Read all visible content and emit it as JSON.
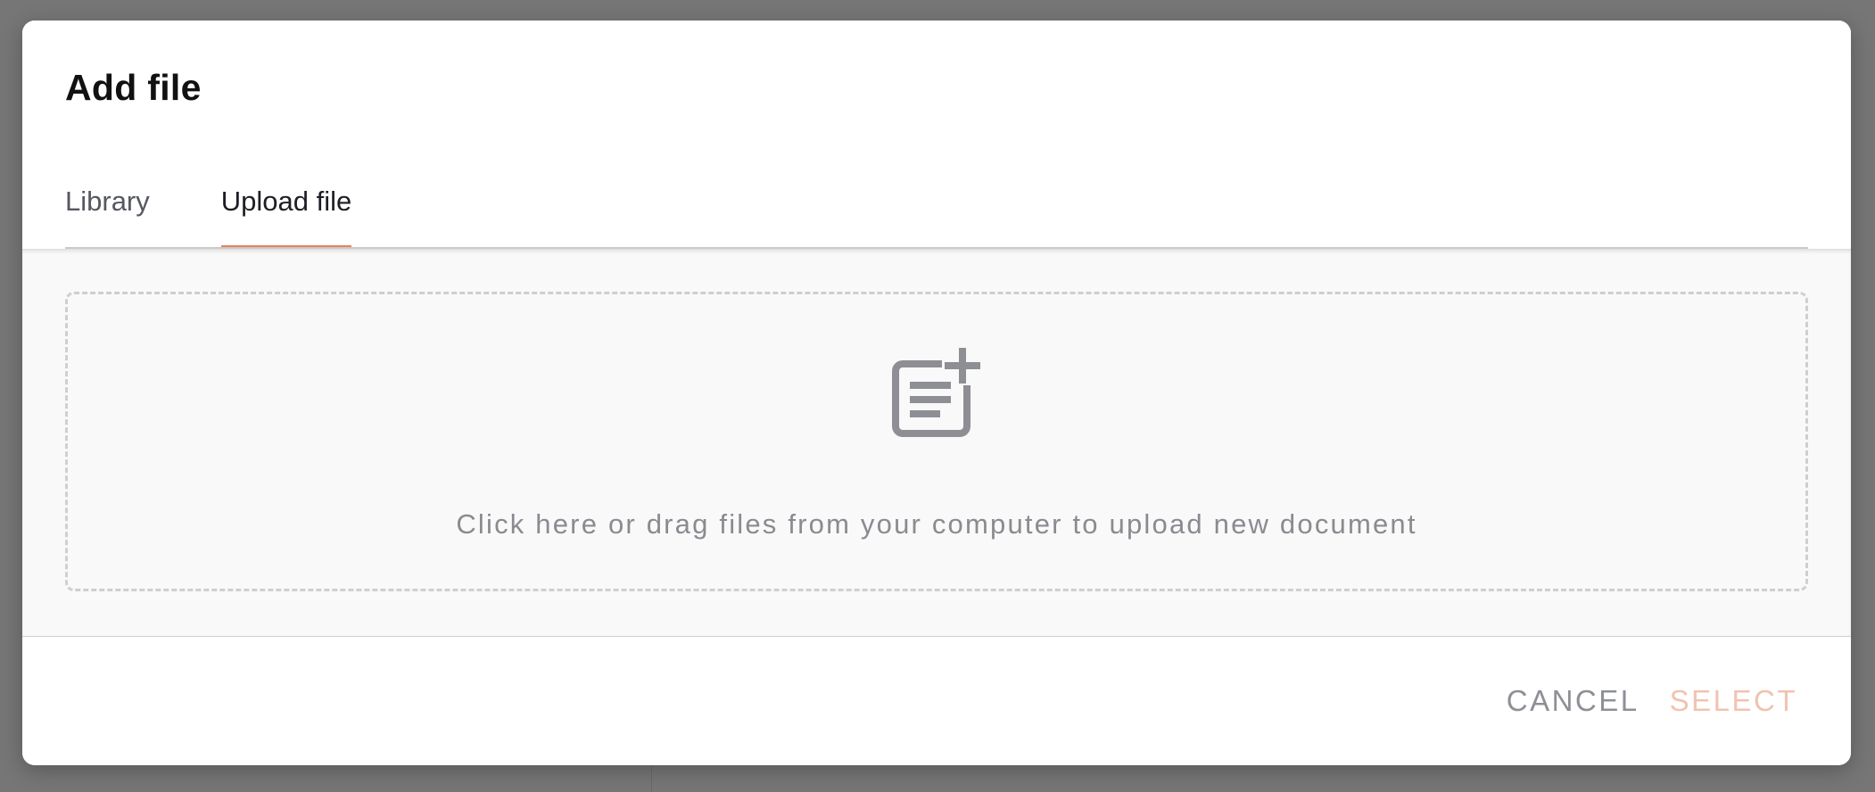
{
  "dialog": {
    "title": "Add file"
  },
  "tabs": [
    {
      "label": "Library",
      "active": false
    },
    {
      "label": "Upload file",
      "active": true
    }
  ],
  "dropzone": {
    "icon": "note-add-icon",
    "text": "Click here or drag files from your computer to upload new document"
  },
  "footer": {
    "cancel_label": "CANCEL",
    "select_label": "SELECT"
  },
  "colors": {
    "accent": "#e8825e",
    "select_disabled": "#f1c3b0",
    "muted_text": "#8a8b90",
    "overlay": "#767676"
  }
}
